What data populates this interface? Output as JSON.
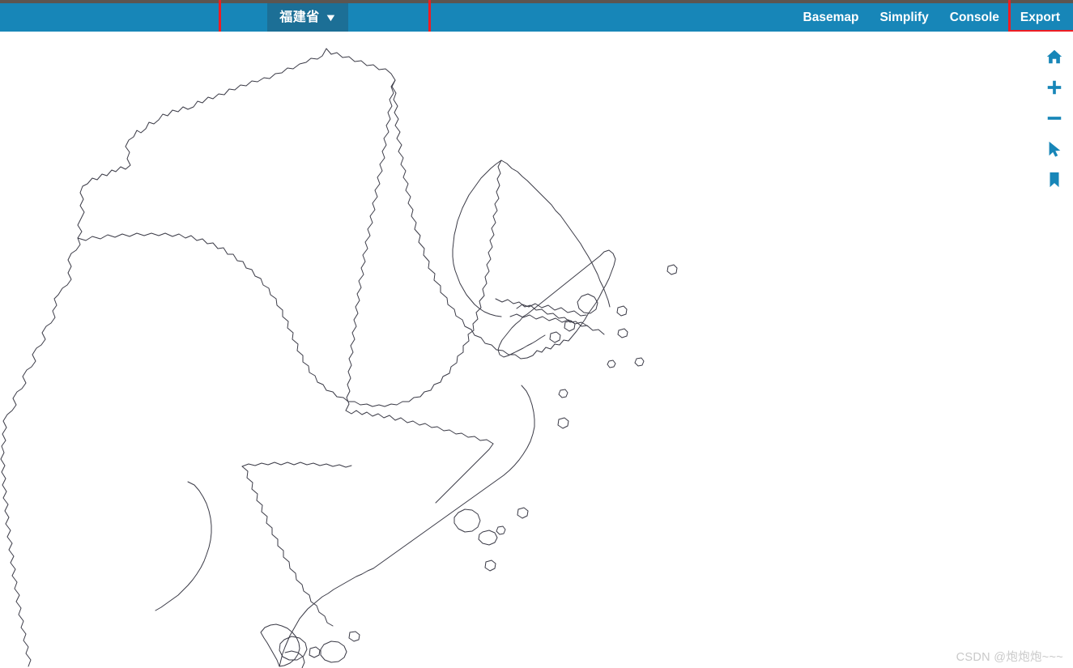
{
  "header": {
    "province_selector": {
      "label": "福建省",
      "caret": "▼",
      "icon": "chevron-down-icon"
    },
    "nav_items": [
      {
        "label": "Basemap"
      },
      {
        "label": "Simplify"
      },
      {
        "label": "Console"
      },
      {
        "label": "Export"
      }
    ],
    "colors": {
      "bar": "#1786b8",
      "selector_bg": "#1c6f96",
      "text": "#ffffff",
      "top_strip": "#5c5550"
    }
  },
  "annotations": {
    "color": "#ee1d23",
    "boxes": [
      {
        "target": "province-selector-region"
      },
      {
        "target": "export-button"
      }
    ]
  },
  "tools": [
    {
      "name": "home-icon",
      "title": "Home"
    },
    {
      "name": "plus-icon",
      "title": "Zoom in"
    },
    {
      "name": "minus-icon",
      "title": "Zoom out"
    },
    {
      "name": "cursor-icon",
      "title": "Select"
    },
    {
      "name": "bookmark-icon",
      "title": "Bookmark"
    }
  ],
  "tools_color": "#1786b8",
  "map": {
    "region": "福建省",
    "stroke": "#3a3a46",
    "fill": "#ffffff",
    "background": "#ffffff"
  },
  "watermark": {
    "text": "CSDN @炮炮炮~~~"
  }
}
